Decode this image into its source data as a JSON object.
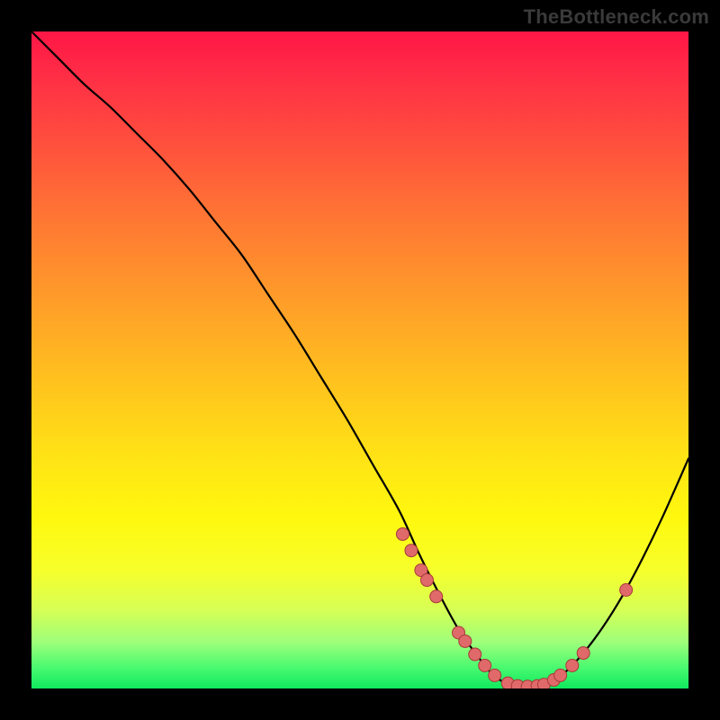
{
  "watermark": "TheBottleneck.com",
  "colors": {
    "dot_fill": "#e06a6a",
    "dot_stroke": "#a83a3a",
    "curve": "#000000"
  },
  "chart_data": {
    "type": "line",
    "title": "",
    "xlabel": "",
    "ylabel": "",
    "xlim": [
      0,
      100
    ],
    "ylim": [
      0,
      100
    ],
    "grid": false,
    "series": [
      {
        "name": "bottleneck-curve",
        "x": [
          0,
          4,
          8,
          12,
          16,
          20,
          24,
          28,
          32,
          36,
          40,
          44,
          48,
          52,
          56,
          59,
          62,
          65,
          68,
          70,
          72,
          74,
          76,
          78,
          81,
          84,
          87,
          90,
          93,
          96,
          100
        ],
        "y": [
          100,
          96,
          92,
          88.5,
          84.5,
          80.5,
          76,
          71,
          66,
          60,
          54,
          47.5,
          41,
          34,
          27,
          20.5,
          14.5,
          9,
          4.8,
          2.3,
          0.9,
          0.3,
          0.2,
          0.6,
          2.3,
          5.4,
          9.4,
          14.2,
          19.8,
          26,
          35
        ]
      }
    ],
    "markers": {
      "name": "highlighted-points",
      "x": [
        56.5,
        57.8,
        59.3,
        60.2,
        61.6,
        65.0,
        66.0,
        67.5,
        69.0,
        70.5,
        72.5,
        74.0,
        75.5,
        77.0,
        78.0,
        79.5,
        80.5,
        82.3,
        84.0,
        90.5
      ],
      "y": [
        23.5,
        21.0,
        18.0,
        16.5,
        14.0,
        8.5,
        7.2,
        5.2,
        3.5,
        2.0,
        0.8,
        0.4,
        0.3,
        0.4,
        0.6,
        1.3,
        2.0,
        3.5,
        5.4,
        15.0
      ]
    }
  }
}
